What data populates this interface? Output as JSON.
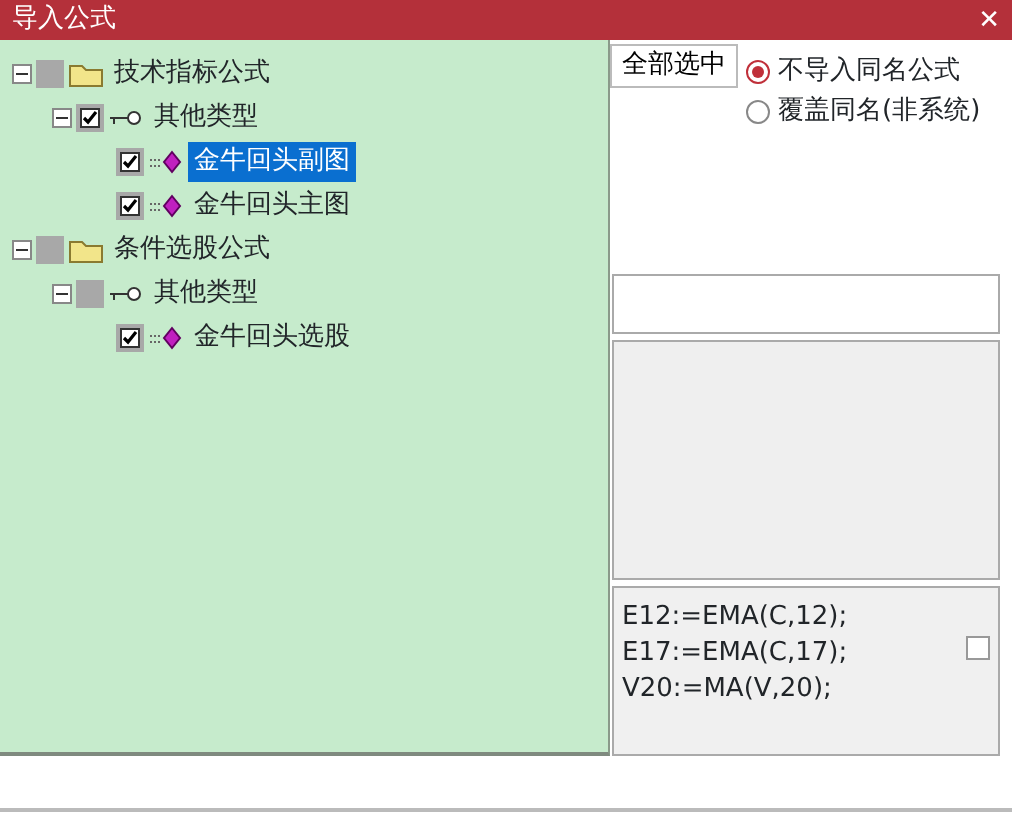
{
  "window": {
    "title": "导入公式",
    "close": "✕"
  },
  "tree": [
    {
      "label": "技术指标公式",
      "kind": "folder",
      "checked": false,
      "expanded": true,
      "selected": false,
      "children": [
        {
          "label": "其他类型",
          "kind": "key",
          "checked": true,
          "expanded": true,
          "selected": false,
          "children": [
            {
              "label": "金牛回头副图",
              "kind": "formula",
              "checked": true,
              "selected": true
            },
            {
              "label": "金牛回头主图",
              "kind": "formula",
              "checked": true,
              "selected": false
            }
          ]
        }
      ]
    },
    {
      "label": "条件选股公式",
      "kind": "folder",
      "checked": false,
      "expanded": true,
      "selected": false,
      "children": [
        {
          "label": "其他类型",
          "kind": "key",
          "checked": false,
          "expanded": true,
          "selected": false,
          "children": [
            {
              "label": "金牛回头选股",
              "kind": "formula",
              "checked": true,
              "selected": false
            }
          ]
        }
      ]
    }
  ],
  "select_all_button": "全部选中",
  "options": [
    {
      "label": "不导入同名公式",
      "selected": true
    },
    {
      "label": "覆盖同名(非系统)",
      "selected": false
    }
  ],
  "code_lines": [
    "E12:=EMA(C,12);",
    "E17:=EMA(C,17);",
    "V20:=MA(V,20);"
  ],
  "code_checkbox": {
    "checked": false
  }
}
